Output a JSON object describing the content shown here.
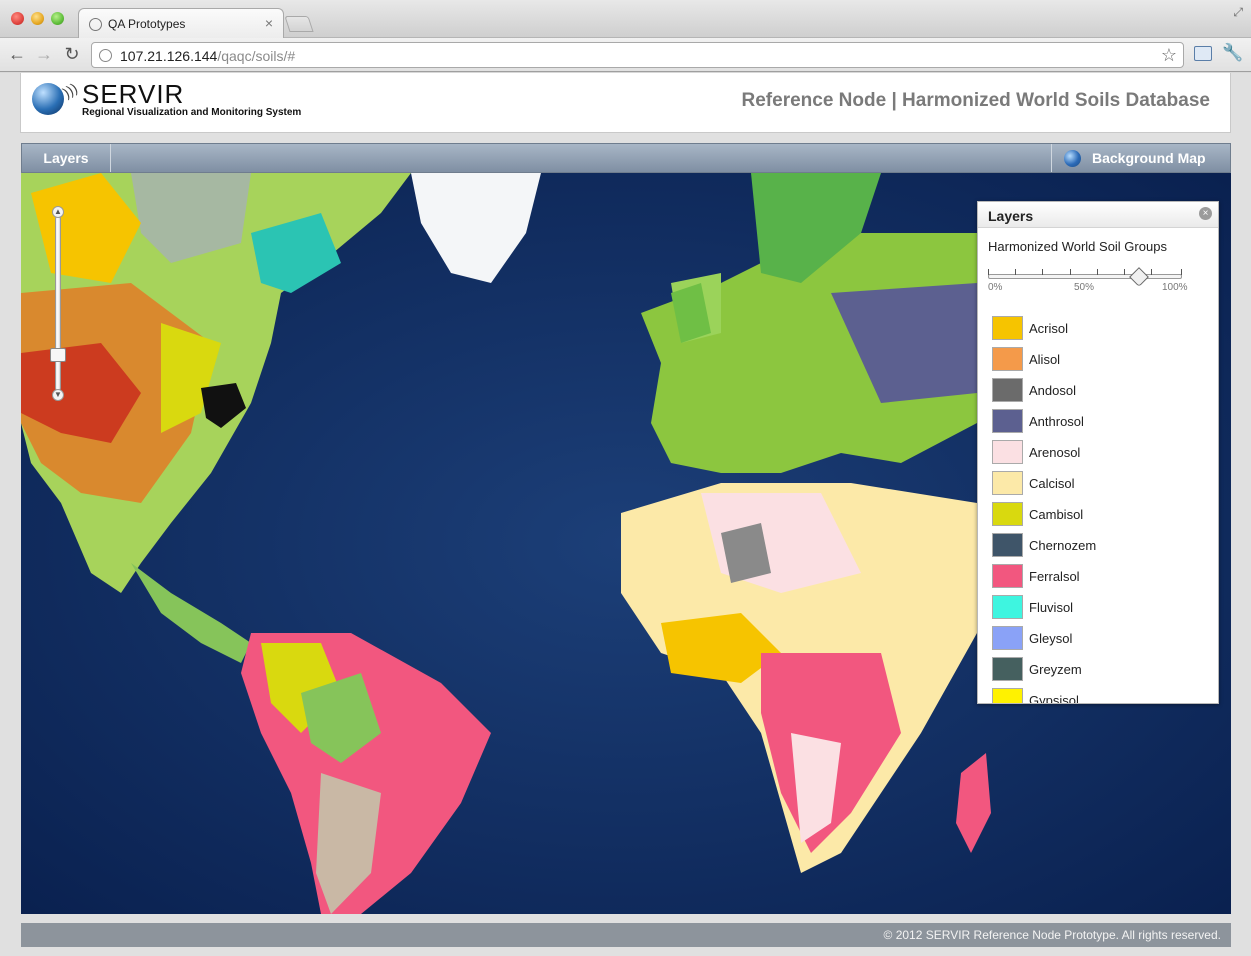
{
  "browser": {
    "tab_title": "QA Prototypes",
    "tab_close": "×",
    "url_host": "107.21.126.144",
    "url_path": "/qaqc/soils/#",
    "icons": [
      "back-icon",
      "forward-icon",
      "reload-icon",
      "star-icon",
      "extension-icon",
      "wrench-icon"
    ]
  },
  "header": {
    "logo_name": "SERVIR",
    "logo_subtitle": "Regional Visualization and Monitoring System",
    "page_title": "Reference Node | Harmonized World Soils Database"
  },
  "mapbar": {
    "layers_label": "Layers",
    "background_label": "Background Map"
  },
  "layers_panel": {
    "title": "Layers",
    "group_title": "Harmonized World Soil Groups",
    "opacity_percent": 78,
    "slider_labels": [
      "0%",
      "50%",
      "100%"
    ],
    "legend": [
      {
        "name": "Acrisol",
        "color": "#f6c400"
      },
      {
        "name": "Alisol",
        "color": "#f49a4a"
      },
      {
        "name": "Andosol",
        "color": "#6b6b6b"
      },
      {
        "name": "Anthrosol",
        "color": "#5c6090"
      },
      {
        "name": "Arenosol",
        "color": "#fbe0e3"
      },
      {
        "name": "Calcisol",
        "color": "#fce9a8"
      },
      {
        "name": "Cambisol",
        "color": "#d9d90f"
      },
      {
        "name": "Chernozem",
        "color": "#3f5569"
      },
      {
        "name": "Ferralsol",
        "color": "#f2577f"
      },
      {
        "name": "Fluvisol",
        "color": "#3ef5e0"
      },
      {
        "name": "Gleysol",
        "color": "#8aa2f7"
      },
      {
        "name": "Greyzem",
        "color": "#45605f"
      },
      {
        "name": "Gypsisol",
        "color": "#fff200"
      }
    ]
  },
  "footer": {
    "copyright": "© 2012 SERVIR Reference Node Prototype.  All rights reserved."
  }
}
